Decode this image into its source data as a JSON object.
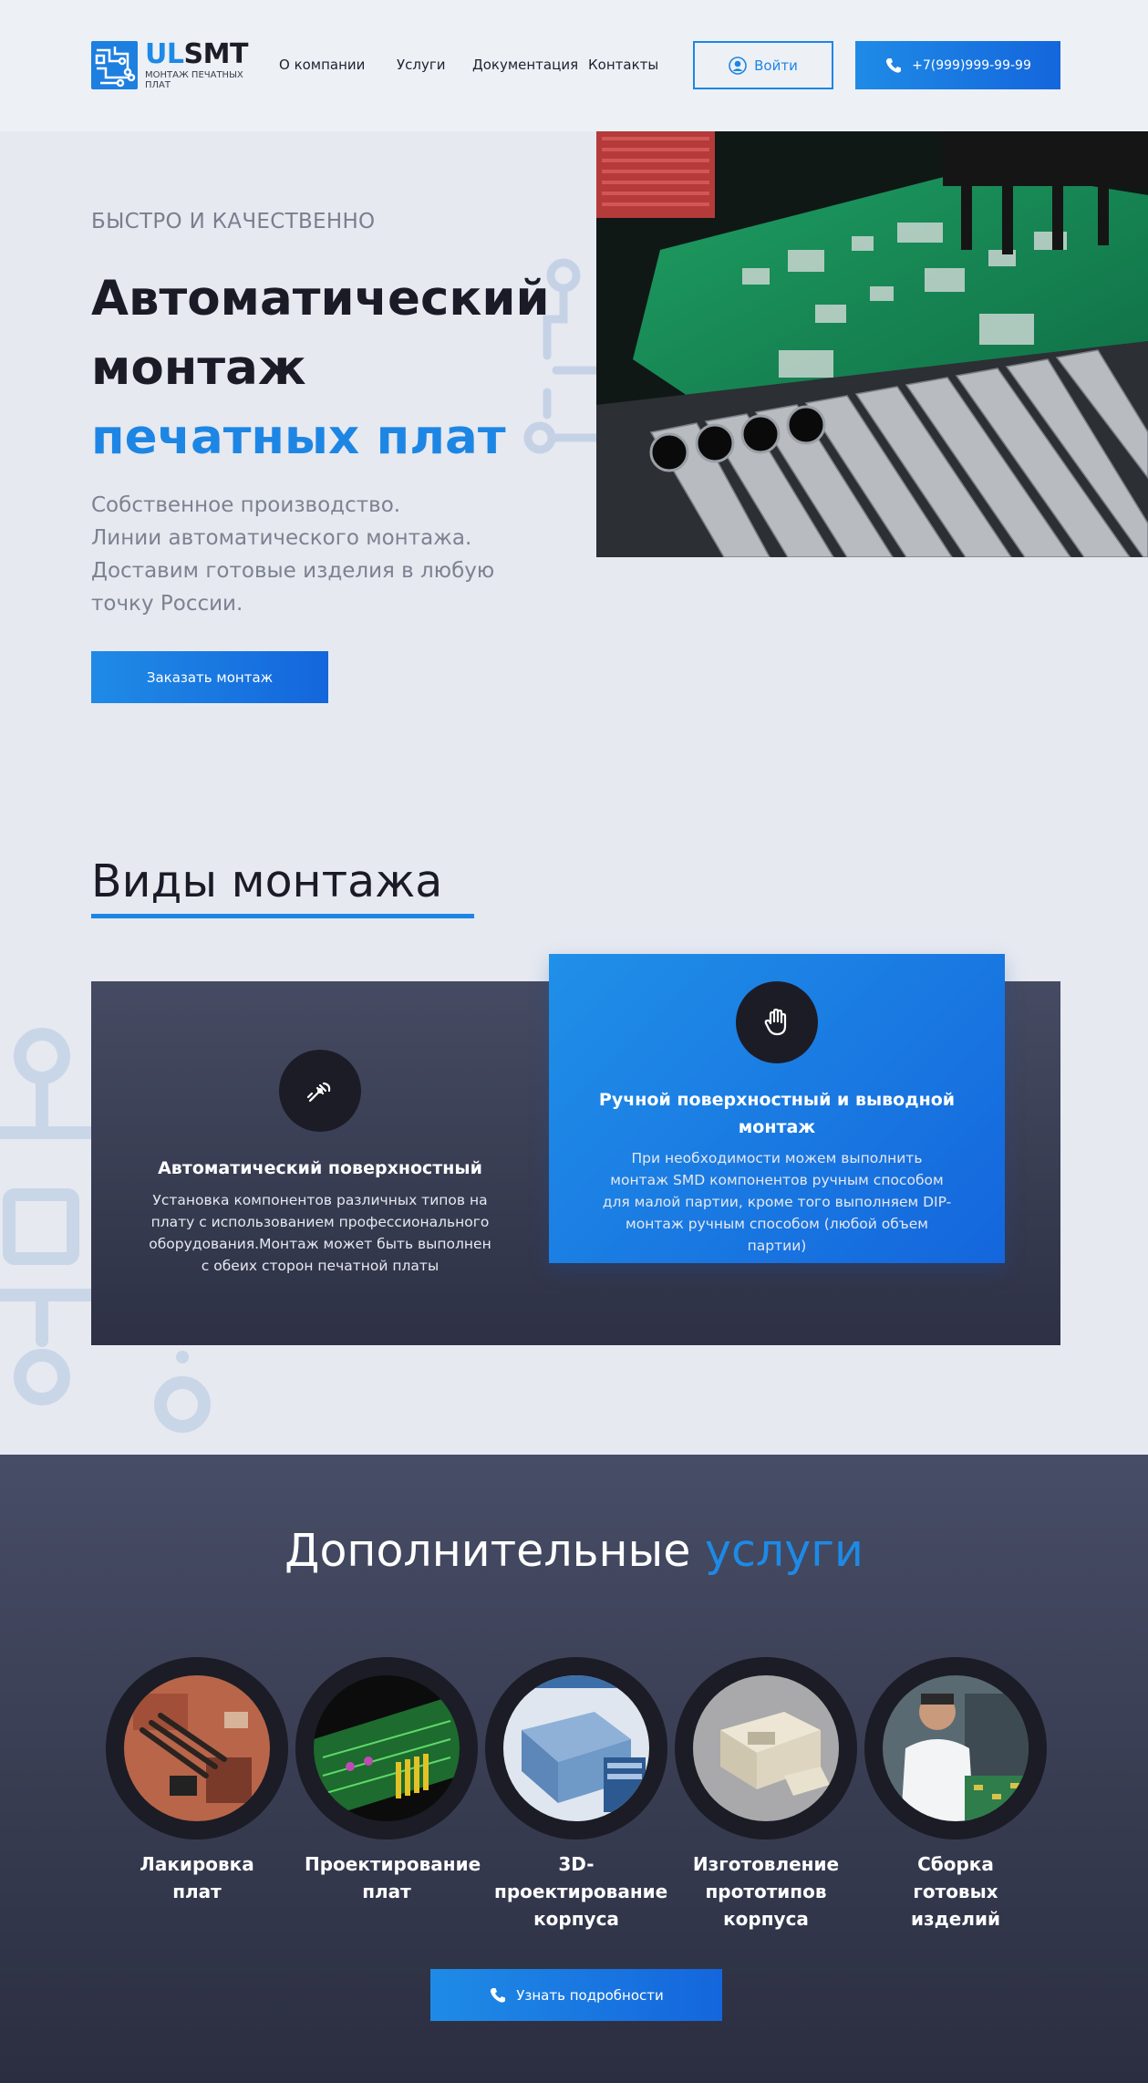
{
  "header": {
    "logo_ul": "UL",
    "logo_smt": "SMT",
    "logo_sub": "МОНТАЖ ПЕЧАТНЫХ ПЛАТ",
    "nav": [
      "О компании",
      "Услуги",
      "Документация",
      "Контакты"
    ],
    "login_label": "Войти",
    "phone_label": "+7(999)999-99-99"
  },
  "hero": {
    "kicker": "БЫСТРО И КАЧЕСТВЕННО",
    "title_line1": "Автоматический",
    "title_line2": "монтаж",
    "title_accent": "печатных плат",
    "description_lines": [
      "Собственное производство.",
      "Линии автоматического монтажа.",
      "Доставим готовые изделия в любую точку России."
    ],
    "cta_label": "Заказать монтаж"
  },
  "types": {
    "title": "Виды монтажа",
    "items": [
      {
        "name": "Автоматический поверхностный",
        "desc": "Установка компонентов различных типов на плату с использованием профессионального оборудования.Монтаж может быть выполнен с обеих сторон печатной платы",
        "icon": "solder-icon"
      },
      {
        "name": "Ручной поверхностный и выводной монтаж",
        "desc": "При необходимости можем выполнить монтаж SMD компонентов ручным способом для малой партии, кроме того выполняем DIP-монтаж ручным способом (любой объем партии)",
        "icon": "hand-icon"
      }
    ]
  },
  "extra": {
    "title_main": "Дополнительные",
    "title_accent": "услуги",
    "services": [
      {
        "label": "Лакировка плат"
      },
      {
        "label": "Проектирование плат"
      },
      {
        "label": "3D-проектирование корпуса"
      },
      {
        "label": "Изготовление прототипов корпуса"
      },
      {
        "label": "Сборка готовых изделий"
      }
    ],
    "cta_label": "Узнать подробности"
  },
  "colors": {
    "accent": "#1d86e4",
    "dark": "#1c1c26",
    "panel": "#3c4157",
    "bg": "#e6e9f0"
  }
}
